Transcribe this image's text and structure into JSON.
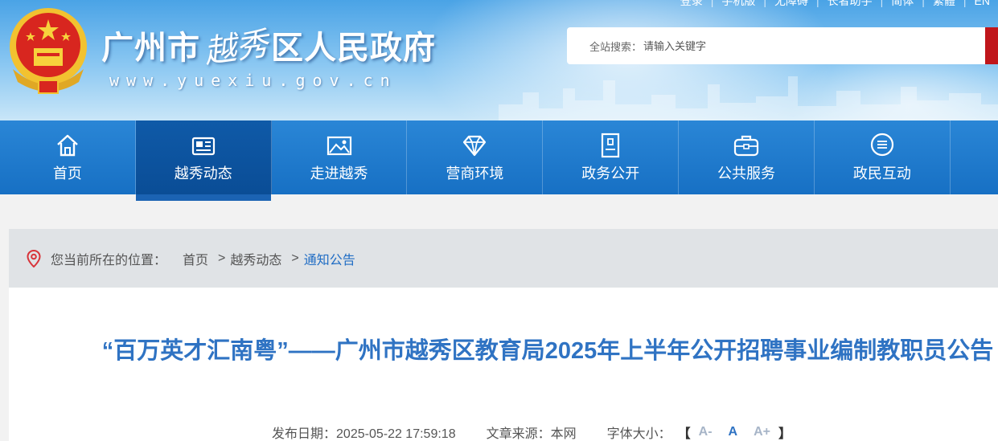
{
  "header": {
    "title_part1": "广州市",
    "title_part2": "越秀",
    "title_part3": "区人民政府",
    "url": "www.yuexiu.gov.cn",
    "top_links": [
      "登录",
      "手机版",
      "无障碍",
      "长者助手",
      "简体",
      "繁體",
      "EN"
    ],
    "search": {
      "label": "全站搜索：",
      "placeholder": "请输入关键字"
    }
  },
  "nav": {
    "items": [
      {
        "label": "首页",
        "icon": "home-icon"
      },
      {
        "label": "越秀动态",
        "icon": "newspaper-icon"
      },
      {
        "label": "走进越秀",
        "icon": "picture-icon"
      },
      {
        "label": "营商环境",
        "icon": "diamond-icon"
      },
      {
        "label": "政务公开",
        "icon": "document-icon"
      },
      {
        "label": "公共服务",
        "icon": "briefcase-icon"
      },
      {
        "label": "政民互动",
        "icon": "chat-icon"
      }
    ],
    "active_index": 1
  },
  "breadcrumb": {
    "label": "您当前所在的位置：",
    "items": [
      "首页",
      "越秀动态",
      "通知公告"
    ]
  },
  "article": {
    "title": "“百万英才汇南粤”——广州市越秀区教育局2025年上半年公开招聘事业编制教职员公告",
    "date_label": "发布日期：",
    "date": "2025-05-22 17:59:18",
    "source_label": "文章来源：",
    "source": "本网",
    "font_size_label": "字体大小：",
    "bracket_open": "【",
    "bracket_close": "】",
    "font_sizes": [
      "A-",
      "A",
      "A+"
    ]
  },
  "colors": {
    "nav_bg": "#1770c4",
    "nav_active": "#0a4d96",
    "title_blue": "#2f73c3",
    "search_btn": "#c0161b"
  }
}
